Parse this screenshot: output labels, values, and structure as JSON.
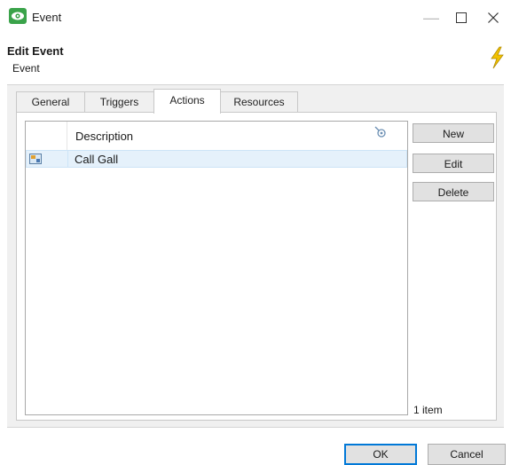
{
  "window": {
    "title": "Event"
  },
  "header": {
    "title": "Edit Event",
    "subtitle": "Event"
  },
  "tabs": [
    {
      "label": "General"
    },
    {
      "label": "Triggers"
    },
    {
      "label": "Actions",
      "active": true
    },
    {
      "label": "Resources"
    }
  ],
  "list": {
    "column_header": "Description",
    "rows": [
      {
        "label": "Call Gall"
      }
    ],
    "item_count": "1 item"
  },
  "side_buttons": {
    "new": "New",
    "edit": "Edit",
    "delete": "Delete"
  },
  "footer": {
    "ok": "OK",
    "cancel": "Cancel"
  },
  "icons": {
    "app": "eye-icon",
    "header": "lightning-bolt-icon",
    "column_settings": "column-settings-icon",
    "row": "action-icon"
  },
  "colors": {
    "app_icon": "#3aa34a",
    "selected_row": "#e5f1fb",
    "accent": "#0078d7",
    "bolt": "#e6b800"
  }
}
